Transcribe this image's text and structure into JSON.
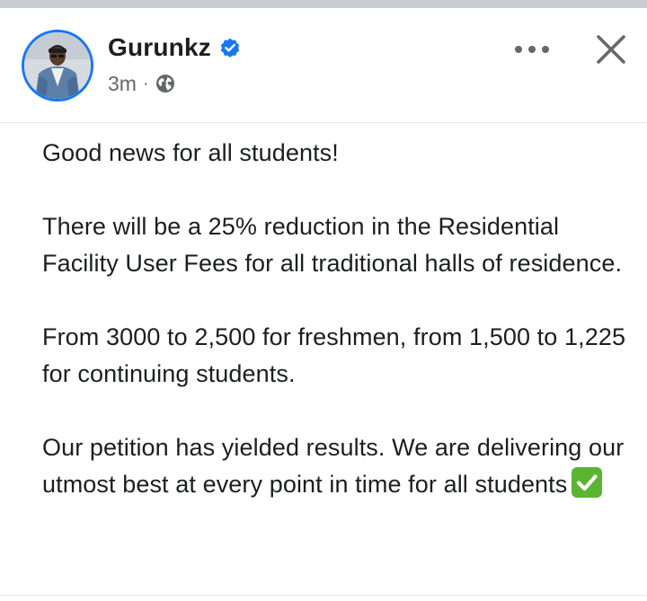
{
  "post": {
    "author": "Gurunkz",
    "timestamp": "3m",
    "separator": "·",
    "paragraphs": [
      "Good news for all students!",
      "There will be a 25% reduction in the Residential Facility User Fees for all traditional halls of residence.",
      "From 3000 to 2,500 for freshmen, from 1,500 to 1,225 for continuing students.",
      "Our petition has yielded results. We are delivering our utmost best at every point in time for all students"
    ]
  },
  "icons": {
    "verified": "verified-badge-icon",
    "privacy": "globe-icon",
    "more": "more-horizontal-icon",
    "close": "close-icon",
    "emoji": "check-mark-button-emoji"
  },
  "colors": {
    "brand_blue": "#1877f2",
    "text": "#1c1e21",
    "secondary_text": "#65676b",
    "divider": "#e4e6eb",
    "emoji_green": "#5bb531"
  }
}
